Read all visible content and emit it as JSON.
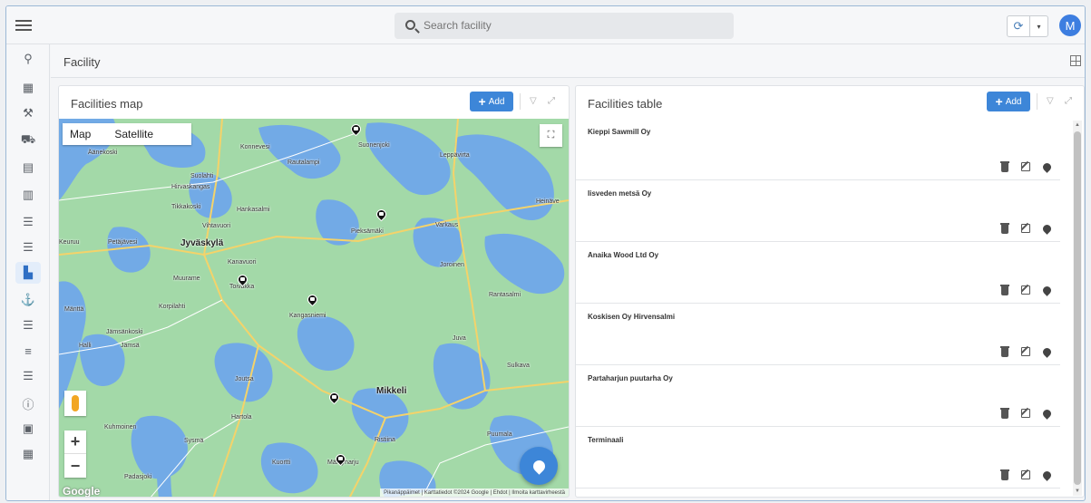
{
  "header": {
    "search_placeholder": "Search facility",
    "avatar_initial": "M",
    "refresh_icon": "⟳",
    "dropdown_icon": "▾"
  },
  "sidebar": {
    "items": [
      {
        "icon": "location-pin-icon",
        "glyph": "⚲"
      },
      {
        "icon": "table-icon",
        "glyph": "▦"
      },
      {
        "icon": "wrench-icon",
        "glyph": "⚒"
      },
      {
        "icon": "truck-icon",
        "glyph": "⛟"
      },
      {
        "icon": "form-icon",
        "glyph": "▤"
      },
      {
        "icon": "bar-chart-icon",
        "glyph": "▥"
      },
      {
        "icon": "list-icon",
        "glyph": "☰"
      },
      {
        "icon": "list-icon-2",
        "glyph": "☰"
      },
      {
        "icon": "factory-icon",
        "glyph": "▙",
        "active": true
      },
      {
        "icon": "anchor-icon",
        "glyph": "⚓"
      },
      {
        "icon": "list-icon-3",
        "glyph": "☰"
      },
      {
        "icon": "sliders-icon",
        "glyph": "≡"
      },
      {
        "icon": "list-icon-4",
        "glyph": "☰"
      },
      {
        "icon": "info-icon",
        "glyph": "ⓘ"
      },
      {
        "icon": "feedback-icon",
        "glyph": "▣"
      },
      {
        "icon": "apps-grid-icon",
        "glyph": "▦"
      }
    ]
  },
  "page": {
    "title": "Facility"
  },
  "map_panel": {
    "title": "Facilities map",
    "add_label": "Add",
    "map_type_options": [
      "Map",
      "Satellite"
    ],
    "google_logo": "Google",
    "attribution": "Pikanäppäimet | Karttatiedot ©2024 Google | Ehdot | Ilmoita karttavirheestä",
    "towns": [
      {
        "name": "Konnevesi"
      },
      {
        "name": "Suonenjoki"
      },
      {
        "name": "Äänekoski"
      },
      {
        "name": "Rautalampi"
      },
      {
        "name": "Suolahti"
      },
      {
        "name": "Hirvaskangas"
      },
      {
        "name": "Leppävirta"
      },
      {
        "name": "Tikkakoski"
      },
      {
        "name": "Hankasalmi"
      },
      {
        "name": "Heinäve"
      },
      {
        "name": "Vihtavuori"
      },
      {
        "name": "Pieksämäki"
      },
      {
        "name": "Varkaus"
      },
      {
        "name": "Keuruu"
      },
      {
        "name": "Petäjävesi"
      },
      {
        "name": "Jyväskylä",
        "big": true
      },
      {
        "name": "Kanavuori"
      },
      {
        "name": "Joroinen"
      },
      {
        "name": "Muurame"
      },
      {
        "name": "Toivakka"
      },
      {
        "name": "Korpilahti"
      },
      {
        "name": "Rantasalmi"
      },
      {
        "name": "Mänttä"
      },
      {
        "name": "Kangasniemi"
      },
      {
        "name": "Jämsänkoski"
      },
      {
        "name": "Juva"
      },
      {
        "name": "Halli"
      },
      {
        "name": "Jämsä"
      },
      {
        "name": "Sulkava"
      },
      {
        "name": "Joutsa"
      },
      {
        "name": "Mikkeli",
        "big": true
      },
      {
        "name": "Hartola"
      },
      {
        "name": "Kuhmoinen"
      },
      {
        "name": "Sysmä"
      },
      {
        "name": "Ristiina"
      },
      {
        "name": "Puumala"
      },
      {
        "name": "Kuortti"
      },
      {
        "name": "Mäntyharju"
      },
      {
        "name": "Padasjoki"
      }
    ]
  },
  "table_panel": {
    "title": "Facilities table",
    "add_label": "Add",
    "rows": [
      {
        "name": "Kieppi Sawmill Oy"
      },
      {
        "name": "Iisveden metsä Oy"
      },
      {
        "name": "Anaika Wood Ltd Oy"
      },
      {
        "name": "Koskisen Oy Hirvensalmi"
      },
      {
        "name": "Partaharjun puutarha Oy"
      },
      {
        "name": "Terminaali"
      }
    ]
  },
  "colors": {
    "accent": "#3d86d8",
    "map_land": "#9fd7a7",
    "map_water": "#6fa8e6",
    "avatar": "#3d7ee0"
  }
}
